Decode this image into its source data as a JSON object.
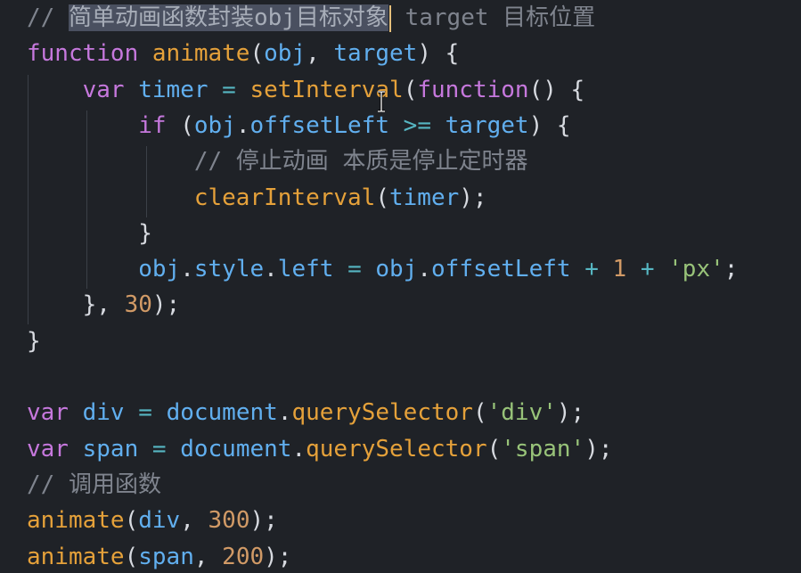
{
  "editor": {
    "lines": [
      [
        {
          "t": "// ",
          "c": "comment"
        },
        {
          "t": "简单动画函数封装obj目标对象",
          "c": "sel"
        },
        {
          "t": "",
          "c": "cursor"
        },
        {
          "t": " target 目标位置",
          "c": "comment"
        }
      ],
      [
        {
          "t": "function ",
          "c": "kw"
        },
        {
          "t": "animate",
          "c": "fn"
        },
        {
          "t": "(",
          "c": "punc"
        },
        {
          "t": "obj",
          "c": "var"
        },
        {
          "t": ", ",
          "c": "punc"
        },
        {
          "t": "target",
          "c": "var"
        },
        {
          "t": ") {",
          "c": "punc"
        }
      ],
      [
        {
          "t": "    ",
          "c": "punc"
        },
        {
          "t": "var ",
          "c": "kw"
        },
        {
          "t": "timer",
          "c": "var"
        },
        {
          "t": " = ",
          "c": "op"
        },
        {
          "t": "setInterval",
          "c": "fn"
        },
        {
          "t": "(",
          "c": "punc"
        },
        {
          "t": "function",
          "c": "kw"
        },
        {
          "t": "() {",
          "c": "punc"
        }
      ],
      [
        {
          "t": "        ",
          "c": "punc"
        },
        {
          "t": "if ",
          "c": "kw"
        },
        {
          "t": "(",
          "c": "punc"
        },
        {
          "t": "obj",
          "c": "var"
        },
        {
          "t": ".",
          "c": "punc"
        },
        {
          "t": "offsetLeft",
          "c": "prop"
        },
        {
          "t": " >= ",
          "c": "op"
        },
        {
          "t": "target",
          "c": "var"
        },
        {
          "t": ") {",
          "c": "punc"
        }
      ],
      [
        {
          "t": "            ",
          "c": "punc"
        },
        {
          "t": "// 停止动画 本质是停止定时器",
          "c": "comment"
        }
      ],
      [
        {
          "t": "            ",
          "c": "punc"
        },
        {
          "t": "clearInterval",
          "c": "fn"
        },
        {
          "t": "(",
          "c": "punc"
        },
        {
          "t": "timer",
          "c": "var"
        },
        {
          "t": ");",
          "c": "punc"
        }
      ],
      [
        {
          "t": "        ",
          "c": "punc"
        },
        {
          "t": "}",
          "c": "punc"
        }
      ],
      [
        {
          "t": "        ",
          "c": "punc"
        },
        {
          "t": "obj",
          "c": "var"
        },
        {
          "t": ".",
          "c": "punc"
        },
        {
          "t": "style",
          "c": "prop"
        },
        {
          "t": ".",
          "c": "punc"
        },
        {
          "t": "left",
          "c": "prop"
        },
        {
          "t": " = ",
          "c": "op"
        },
        {
          "t": "obj",
          "c": "var"
        },
        {
          "t": ".",
          "c": "punc"
        },
        {
          "t": "offsetLeft",
          "c": "prop"
        },
        {
          "t": " + ",
          "c": "op"
        },
        {
          "t": "1",
          "c": "num"
        },
        {
          "t": " + ",
          "c": "op"
        },
        {
          "t": "'px'",
          "c": "str"
        },
        {
          "t": ";",
          "c": "punc"
        }
      ],
      [
        {
          "t": "    ",
          "c": "punc"
        },
        {
          "t": "}, ",
          "c": "punc"
        },
        {
          "t": "30",
          "c": "num"
        },
        {
          "t": ");",
          "c": "punc"
        }
      ],
      [
        {
          "t": "}",
          "c": "punc"
        }
      ],
      [],
      [
        {
          "t": "var ",
          "c": "kw"
        },
        {
          "t": "div",
          "c": "var"
        },
        {
          "t": " = ",
          "c": "op"
        },
        {
          "t": "document",
          "c": "var"
        },
        {
          "t": ".",
          "c": "punc"
        },
        {
          "t": "querySelector",
          "c": "fn"
        },
        {
          "t": "(",
          "c": "punc"
        },
        {
          "t": "'div'",
          "c": "str"
        },
        {
          "t": ");",
          "c": "punc"
        }
      ],
      [
        {
          "t": "var ",
          "c": "kw"
        },
        {
          "t": "span",
          "c": "var"
        },
        {
          "t": " = ",
          "c": "op"
        },
        {
          "t": "document",
          "c": "var"
        },
        {
          "t": ".",
          "c": "punc"
        },
        {
          "t": "querySelector",
          "c": "fn"
        },
        {
          "t": "(",
          "c": "punc"
        },
        {
          "t": "'span'",
          "c": "str"
        },
        {
          "t": ");",
          "c": "punc"
        }
      ],
      [
        {
          "t": "// 调用函数",
          "c": "comment"
        }
      ],
      [
        {
          "t": "animate",
          "c": "fn"
        },
        {
          "t": "(",
          "c": "punc"
        },
        {
          "t": "div",
          "c": "var"
        },
        {
          "t": ", ",
          "c": "punc"
        },
        {
          "t": "300",
          "c": "num"
        },
        {
          "t": ");",
          "c": "punc"
        }
      ],
      [
        {
          "t": "animate",
          "c": "fn"
        },
        {
          "t": "(",
          "c": "punc"
        },
        {
          "t": "span",
          "c": "var"
        },
        {
          "t": ", ",
          "c": "punc"
        },
        {
          "t": "200",
          "c": "num"
        },
        {
          "t": ");",
          "c": "punc"
        }
      ]
    ]
  },
  "icons": {
    "mouse_cursor": "i-beam-cursor-icon"
  },
  "colors": {
    "background": "#1f2227",
    "keyword": "#c678dd",
    "function": "#e5a13a",
    "variable": "#61afef",
    "string": "#98c379",
    "number": "#d19a66",
    "comment": "#7f848e",
    "selection": "#4a5060"
  }
}
